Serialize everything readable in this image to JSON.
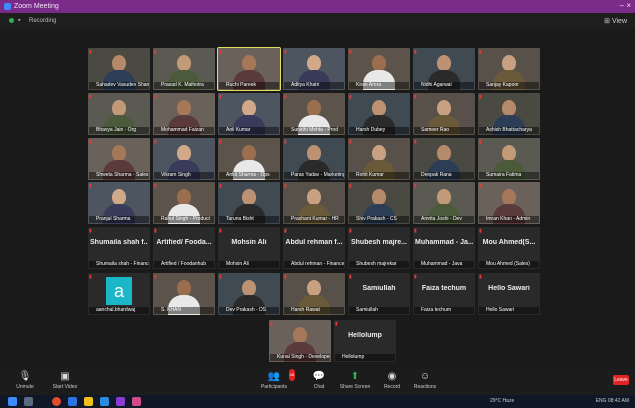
{
  "window": {
    "title": "Zoom Meeting"
  },
  "topbar": {
    "recording_label": "Recording",
    "view_label": "View"
  },
  "tiles_row1": [
    {
      "name": "Sahadev Vasudev Sharma",
      "speaking": false
    },
    {
      "name": "Prasad K. Malhotra",
      "speaking": false
    },
    {
      "name": "Ruchi Pareek",
      "speaking": true
    },
    {
      "name": "Aditya Khatri",
      "speaking": false
    },
    {
      "name": "Kiran Arora",
      "speaking": false
    },
    {
      "name": "Nidhi Agarwal",
      "speaking": false
    },
    {
      "name": "Sanjay Kapoor",
      "speaking": false
    }
  ],
  "tiles_row2": [
    {
      "name": "Bhavya Jain - Org"
    },
    {
      "name": "Mohammad Faizan"
    },
    {
      "name": "Anil Kumar"
    },
    {
      "name": "Sunidhi Mehta - Prod"
    },
    {
      "name": "Harsh Dubey"
    },
    {
      "name": "Sameer Rao"
    },
    {
      "name": "Ashish Bhattacharya"
    }
  ],
  "tiles_row3": [
    {
      "name": "Shweta Sharma - Sales"
    },
    {
      "name": "Vikram Singh"
    },
    {
      "name": "Ankit Sharma - Ops"
    },
    {
      "name": "Paras Yadav - Marketing"
    },
    {
      "name": "Rohit Kumar"
    },
    {
      "name": "Deepak Rana"
    },
    {
      "name": "Sumaira Fatima"
    }
  ],
  "tiles_row4": [
    {
      "name": "Pranjal Sharma"
    },
    {
      "name": "Rahul Singh - Product"
    },
    {
      "name": "Taruna Bisht"
    },
    {
      "name": "Prashant Kumar - HR"
    },
    {
      "name": "Shiv Prakash - CS"
    },
    {
      "name": "Amrita Joshi - Dev"
    },
    {
      "name": "Imran Khan - Admin"
    }
  ],
  "text_row": [
    {
      "big": "Shumaila shah f...",
      "name": "Shumaila shah - Finance"
    },
    {
      "big": "Artified/ Fooda...",
      "name": "Artified / Foodanhub"
    },
    {
      "big": "Mohsin Ali",
      "name": "Mohsin Ali"
    },
    {
      "big": "Abdul rehman f...",
      "name": "Abdul rehman - Finance"
    },
    {
      "big": "Shubesh majre...",
      "name": "Shubesh majrekar"
    },
    {
      "big": "Muhammad - Ja...",
      "name": "Muhammad - Java"
    },
    {
      "big": "Mou Ahmed(S...",
      "name": "Mou Ahmed (Sales)"
    }
  ],
  "mixed_row": [
    {
      "kind": "avatar",
      "letter": "a",
      "name": "aanchal.bhardwaj"
    },
    {
      "kind": "video",
      "name": "S. KHAN"
    },
    {
      "kind": "video",
      "name": "Dev Prakash - DS"
    },
    {
      "kind": "video",
      "name": "Harsh Rawat"
    },
    {
      "kind": "text",
      "big": "Samiullah",
      "name": "Samiullah"
    },
    {
      "kind": "text",
      "big": "Faiza techum",
      "name": "Faiza techum"
    },
    {
      "kind": "text",
      "big": "Hello Sawari",
      "name": "Hello Sawari"
    }
  ],
  "last_row": [
    {
      "kind": "video",
      "name": "Kunal Singh - Developer"
    },
    {
      "kind": "text",
      "big": "Hellolump",
      "name": "Hellolump"
    }
  ],
  "controls": {
    "unmute": "Unmute",
    "start_video": "Start Video",
    "participants": "Participants",
    "participants_count": "46",
    "chat": "Chat",
    "share_screen": "Share Screen",
    "record": "Record",
    "reactions": "Reactions",
    "leave": "Leave"
  },
  "taskbar": {
    "weather": "29°C Haze",
    "tray": "ENG 08:42 AM"
  },
  "colors": {
    "title_bar": "#7a2b8a",
    "speaking": "#e2e05a",
    "muted": "#e23b3b",
    "leave": "#e02424",
    "share": "#2fb24c"
  }
}
